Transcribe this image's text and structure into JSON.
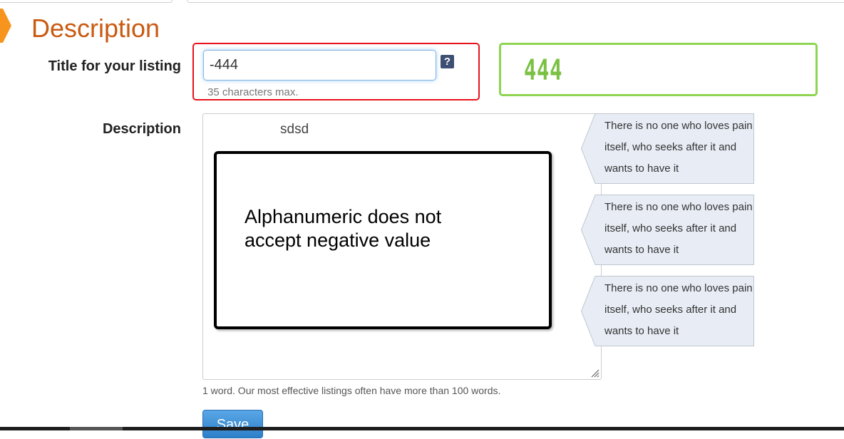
{
  "section": {
    "title": "Description"
  },
  "title_field": {
    "label": "Title for your listing",
    "value": "-444",
    "help_icon": "?",
    "hint": "35 characters max."
  },
  "annotation_green": {
    "text": "444"
  },
  "description_field": {
    "label": "Description",
    "value": "sdsd",
    "word_count": "1 word. Our most effective listings often have more than 100 words."
  },
  "annotation_callout": {
    "text": "Alphanumeric does not accept negative value"
  },
  "tips": [
    {
      "text": "There is no one who loves pain itself, who seeks after it and wants to have it"
    },
    {
      "text": "There is no one who loves pain itself, who seeks after it and wants to have it"
    },
    {
      "text": "There is no one who loves pain itself, who seeks after it and wants to have it"
    }
  ],
  "actions": {
    "save_label": "Save"
  },
  "colors": {
    "title_orange": "#c95a11",
    "marker_orange": "#f7941d",
    "annotation_red": "#e8121c",
    "annotation_green": "#7ac143",
    "button_blue": "#2d7fc9"
  }
}
